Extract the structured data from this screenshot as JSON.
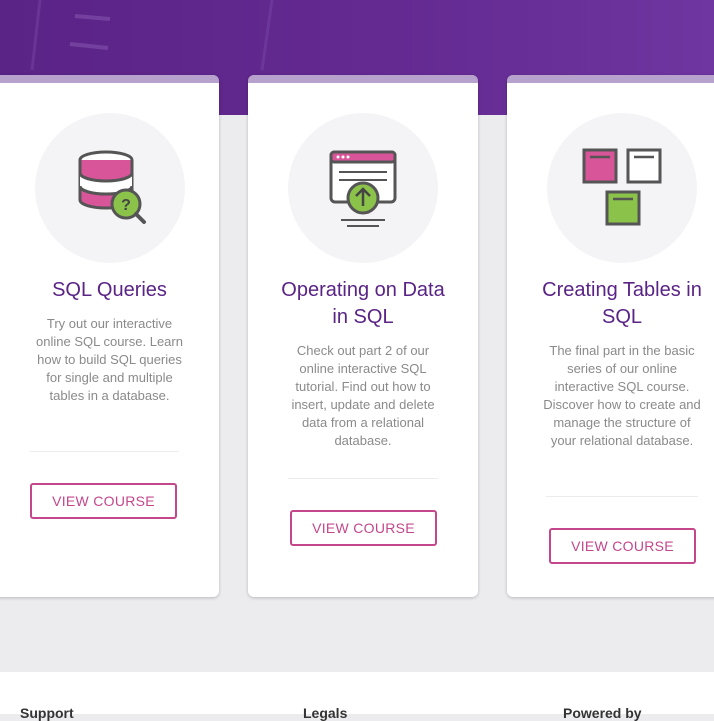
{
  "colors": {
    "brand_purple": "#5a2386",
    "accent_pink": "#c4478c",
    "text_gray": "#8a8a8a",
    "icon_green": "#8bc34a"
  },
  "courses": [
    {
      "title": "SQL Queries",
      "description": "Try out our interactive online SQL course. Learn how to build SQL queries for single and multiple tables in a database.",
      "button": "VIEW COURSE",
      "icon": "database-search-icon"
    },
    {
      "title": "Operating on Data in SQL",
      "description": "Check out part 2 of our online interactive SQL tutorial. Find out how to insert, update and delete data from a relational database.",
      "button": "VIEW COURSE",
      "icon": "browser-upload-icon"
    },
    {
      "title": "Creating Tables in SQL",
      "description": "The final part in the basic series of our online interactive SQL course. Discover how to create and manage the structure of your relational database.",
      "button": "VIEW COURSE",
      "icon": "tables-icon"
    }
  ],
  "footer": {
    "support": "Support",
    "legals": "Legals",
    "powered_by": "Powered by"
  }
}
